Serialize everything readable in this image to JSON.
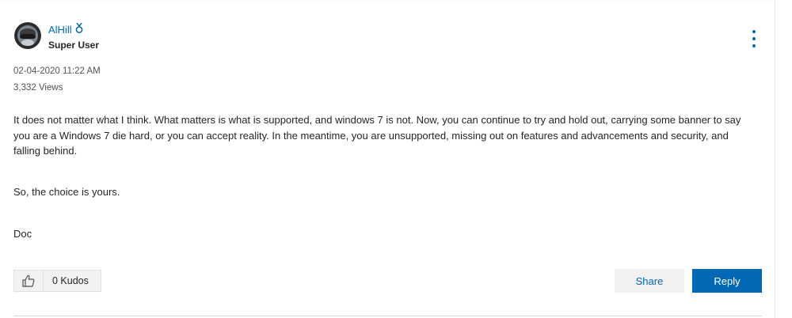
{
  "post": {
    "author": "AlHill",
    "rank": "Super User",
    "date": "02-04-2020 11:22 AM",
    "views": "3,332 Views",
    "body": [
      "It does not matter what I think. What matters is what is supported, and windows 7 is not. Now, you can continue to try and hold out, carrying some banner to say you are a Windows 7 die hard, or you can accept reality. In the meantime, you are unsupported, missing out on features and advancements and security, and falling behind.",
      "So, the choice is yours.",
      "Doc"
    ]
  },
  "footer": {
    "kudos": "0 Kudos",
    "share_label": "Share",
    "reply_label": "Reply"
  },
  "icons": {
    "rank": "medal-icon",
    "options": "kebab-menu-icon",
    "kudo": "thumbs-up-icon"
  },
  "colors": {
    "accent": "#0068b5",
    "text": "#262626",
    "muted": "#525252",
    "button_bg": "#f2f2f2"
  }
}
